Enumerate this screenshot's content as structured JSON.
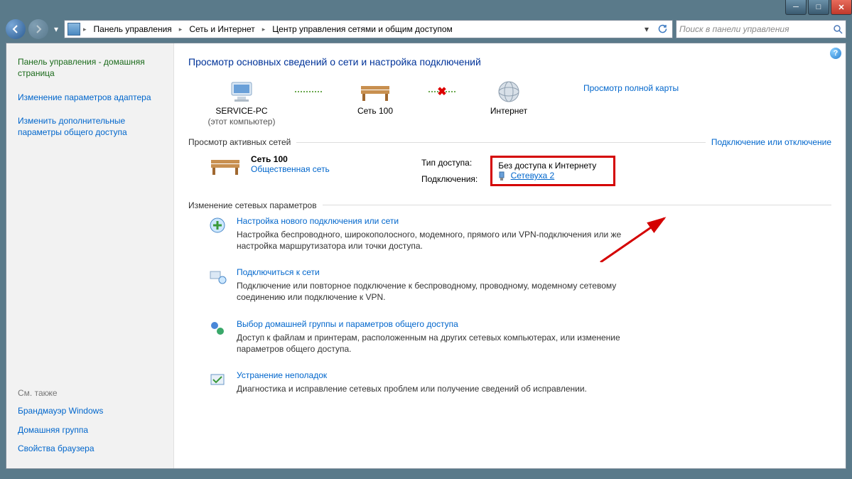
{
  "breadcrumbs": {
    "root": "",
    "level1": "Панель управления",
    "level2": "Сеть и Интернет",
    "level3": "Центр управления сетями и общим доступом"
  },
  "search": {
    "placeholder": "Поиск в панели управления"
  },
  "sidebar": {
    "home": "Панель управления - домашняя страница",
    "links": [
      "Изменение параметров адаптера",
      "Изменить дополнительные параметры общего доступа"
    ],
    "see_also_label": "См. также",
    "see_also": [
      "Брандмауэр Windows",
      "Домашняя группа",
      "Свойства браузера"
    ]
  },
  "page": {
    "title": "Просмотр основных сведений о сети и настройка подключений",
    "map_link": "Просмотр полной карты",
    "map": {
      "computer": "SERVICE-PC",
      "computer_sub": "(этот компьютер)",
      "network": "Сеть 100",
      "internet": "Интернет"
    },
    "active_networks_title": "Просмотр активных сетей",
    "connect_disconnect": "Подключение или отключение",
    "network": {
      "name": "Сеть 100",
      "type": "Общественная сеть",
      "access_label": "Тип доступа:",
      "access_value": "Без доступа к Интернету",
      "conn_label": "Подключения:",
      "conn_value": "Сетевуха 2"
    },
    "change_settings_title": "Изменение сетевых параметров",
    "tasks": [
      {
        "title": "Настройка нового подключения или сети",
        "desc": "Настройка беспроводного, широкополосного, модемного, прямого или VPN-подключения или же настройка маршрутизатора или точки доступа."
      },
      {
        "title": "Подключиться к сети",
        "desc": "Подключение или повторное подключение к беспроводному, проводному, модемному сетевому соединению или подключение к VPN."
      },
      {
        "title": "Выбор домашней группы и параметров общего доступа",
        "desc": "Доступ к файлам и принтерам, расположенным на других сетевых компьютерах, или изменение параметров общего доступа."
      },
      {
        "title": "Устранение неполадок",
        "desc": "Диагностика и исправление сетевых проблем или получение сведений об исправлении."
      }
    ]
  }
}
